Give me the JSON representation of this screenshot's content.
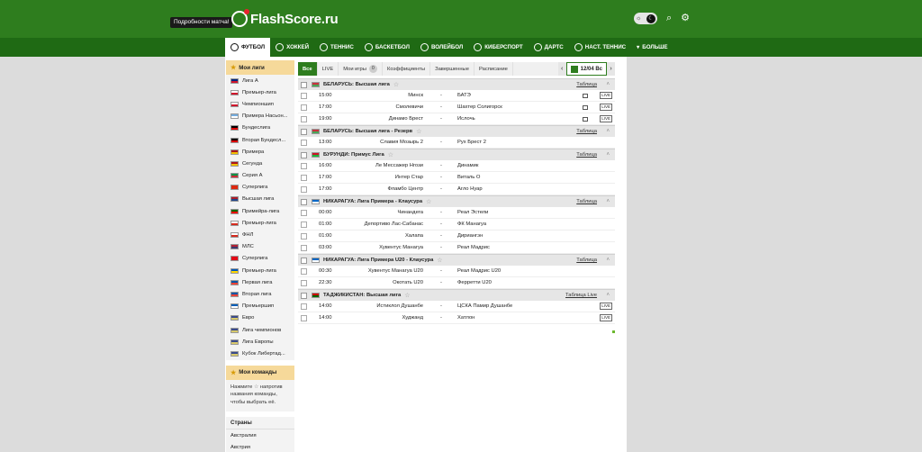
{
  "header": {
    "tooltip": "Подробности матча!",
    "logo_text": "FlashScore.ru",
    "theme_light_glyph": "☼",
    "theme_dark_glyph": "☾",
    "search_glyph": "⌕",
    "settings_glyph": "⚙"
  },
  "nav": {
    "items": [
      {
        "label": "ФУТБОЛ",
        "icon": "football-icon"
      },
      {
        "label": "ХОККЕЙ",
        "icon": "hockey-icon"
      },
      {
        "label": "ТЕННИС",
        "icon": "tennis-icon"
      },
      {
        "label": "БАСКЕТБОЛ",
        "icon": "basketball-icon"
      },
      {
        "label": "ВОЛЕЙБОЛ",
        "icon": "volleyball-icon"
      },
      {
        "label": "КИБЕРСПОРТ",
        "icon": "esports-icon"
      },
      {
        "label": "ДАРТС",
        "icon": "darts-icon"
      },
      {
        "label": "НАСТ. ТЕННИС",
        "icon": "table-tennis-icon"
      },
      {
        "label": "БОЛЬШЕ",
        "icon": "chevron-down-icon"
      }
    ],
    "more_glyph": "▾"
  },
  "sidebar": {
    "my_leagues_title": "Мои лиги",
    "leagues": [
      {
        "label": "Лига А",
        "flag": [
          "#00247d",
          "#cf142b"
        ]
      },
      {
        "label": "Премьер-лига",
        "flag": [
          "#ffffff",
          "#cf142b"
        ]
      },
      {
        "label": "Чемпионшип",
        "flag": [
          "#ffffff",
          "#cf142b"
        ]
      },
      {
        "label": "Примера Насьон...",
        "flag": [
          "#74acdf",
          "#ffffff"
        ]
      },
      {
        "label": "Бундеслига",
        "flag": [
          "#000000",
          "#dd0000"
        ]
      },
      {
        "label": "Вторая Бундесл...",
        "flag": [
          "#000000",
          "#dd0000"
        ]
      },
      {
        "label": "Примера",
        "flag": [
          "#aa151b",
          "#f1bf00"
        ]
      },
      {
        "label": "Сегунда",
        "flag": [
          "#aa151b",
          "#f1bf00"
        ]
      },
      {
        "label": "Серия А",
        "flag": [
          "#009246",
          "#ce2b37"
        ]
      },
      {
        "label": "Суперлига",
        "flag": [
          "#de2910",
          "#de2910"
        ]
      },
      {
        "label": "Высшая лига",
        "flag": [
          "#ae1c28",
          "#21468b"
        ]
      },
      {
        "label": "Примейра-лига",
        "flag": [
          "#006600",
          "#ff0000"
        ]
      },
      {
        "label": "Премьер-лига",
        "flag": [
          "#ffffff",
          "#d52b1e"
        ]
      },
      {
        "label": "ФНЛ",
        "flag": [
          "#ffffff",
          "#d52b1e"
        ]
      },
      {
        "label": "МЛС",
        "flag": [
          "#b22234",
          "#3c3b6e"
        ]
      },
      {
        "label": "Суперлига",
        "flag": [
          "#e30a17",
          "#e30a17"
        ]
      },
      {
        "label": "Премьер-лига",
        "flag": [
          "#0057b7",
          "#ffd700"
        ]
      },
      {
        "label": "Первая лига",
        "flag": [
          "#0055a4",
          "#ef4135"
        ]
      },
      {
        "label": "Вторая лига",
        "flag": [
          "#0055a4",
          "#ef4135"
        ]
      },
      {
        "label": "Премьершип",
        "flag": [
          "#005eb8",
          "#ffffff"
        ]
      },
      {
        "label": "Евро",
        "flag": [
          "#3a4a8a",
          "#d8c96a"
        ]
      },
      {
        "label": "Лига чемпионов",
        "flag": [
          "#3a4a8a",
          "#d8c96a"
        ]
      },
      {
        "label": "Лига Европы",
        "flag": [
          "#3a4a8a",
          "#d8c96a"
        ]
      },
      {
        "label": "Кубок Либертад...",
        "flag": [
          "#3a4a8a",
          "#d8c96a"
        ]
      }
    ],
    "my_teams_title": "Мои команды",
    "my_teams_note_before": "Нажмите",
    "my_teams_note_after": "напротив названия команды, чтобы выбрать её.",
    "countries_title": "Страны",
    "countries": [
      "Австралия",
      "Австрия"
    ]
  },
  "tabs": {
    "items": [
      "Все",
      "LIVE",
      "Мои игры",
      "Коэффициенты",
      "Завершенные",
      "Расписание"
    ],
    "my_games_count": "0",
    "date": "12/04 Вс",
    "prev_glyph": "‹",
    "next_glyph": "›"
  },
  "leagues": [
    {
      "name": "БЕЛАРУСЬ: Высшая лига",
      "flag": [
        "#c8313e",
        "#4aa657"
      ],
      "standings": "Таблица",
      "matches": [
        {
          "time": "15:00",
          "home": "Минск",
          "away": "БАТЭ",
          "tv": true,
          "live": "LIVE"
        },
        {
          "time": "17:00",
          "home": "Смолевичи",
          "away": "Шахтер Солигорск",
          "tv": true,
          "live": "LIVE"
        },
        {
          "time": "19:00",
          "home": "Динамо Брест",
          "away": "Ислочь",
          "tv": true,
          "live": "LIVE"
        }
      ]
    },
    {
      "name": "БЕЛАРУСЬ: Высшая лига - Резерв",
      "flag": [
        "#c8313e",
        "#4aa657"
      ],
      "standings": "Таблица",
      "matches": [
        {
          "time": "13:00",
          "home": "Славия Мозырь 2",
          "away": "Рух Брест 2",
          "tv": false,
          "live": ""
        }
      ]
    },
    {
      "name": "БУРУНДИ: Примус Лига",
      "flag": [
        "#ce1126",
        "#1eb53a"
      ],
      "standings": "Таблица",
      "matches": [
        {
          "time": "16:00",
          "home": "Ле Мессажер Нгози",
          "away": "Динамик",
          "tv": false,
          "live": ""
        },
        {
          "time": "17:00",
          "home": "Интер Стар",
          "away": "Виталь О",
          "tv": false,
          "live": ""
        },
        {
          "time": "17:00",
          "home": "Фламбо Центр",
          "away": "Агло Нуар",
          "tv": false,
          "live": ""
        }
      ]
    },
    {
      "name": "НИКАРАГУА: Лига Примера - Клаусура",
      "flag": [
        "#0067c6",
        "#ffffff"
      ],
      "standings": "Таблица",
      "matches": [
        {
          "time": "00:00",
          "home": "Чинандега",
          "away": "Реал Эстели",
          "tv": false,
          "live": ""
        },
        {
          "time": "01:00",
          "home": "Депортиво Лас-Сабанас",
          "away": "ФК Манагуа",
          "tv": false,
          "live": ""
        },
        {
          "time": "01:00",
          "home": "Халапа",
          "away": "Дириангэн",
          "tv": false,
          "live": ""
        },
        {
          "time": "03:00",
          "home": "Хувентус Манагуа",
          "away": "Реал Мадрис",
          "tv": false,
          "live": ""
        }
      ]
    },
    {
      "name": "НИКАРАГУА: Лига Примера U20 - Клаусура",
      "flag": [
        "#0067c6",
        "#ffffff"
      ],
      "standings": "Таблица",
      "matches": [
        {
          "time": "00:30",
          "home": "Хувентус Манагуа U20",
          "away": "Реал Мадрис U20",
          "tv": false,
          "live": ""
        },
        {
          "time": "22:30",
          "home": "Окотать U20",
          "away": "Ферретти U20",
          "tv": false,
          "live": ""
        }
      ]
    },
    {
      "name": "ТАДЖИКИСТАН: Высшая лига",
      "flag": [
        "#cc0000",
        "#006600"
      ],
      "standings": "Таблица Live",
      "matches": [
        {
          "time": "14:00",
          "home": "Истиклол Душанбе",
          "away": "ЦСКА Памир Душанбе",
          "tv": false,
          "live": "LIVE"
        },
        {
          "time": "14:00",
          "home": "Худжанд",
          "away": "Хатлон",
          "tv": false,
          "live": "LIVE"
        }
      ]
    }
  ],
  "colors": {
    "brand": "#2e7d1e",
    "nav": "#1f6a14",
    "sidebar_header": "#f6d99a",
    "live_dot": "#6bb82e"
  },
  "glyphs": {
    "star": "☆",
    "star_filled": "★",
    "collapse": "˄",
    "dash": "-"
  }
}
